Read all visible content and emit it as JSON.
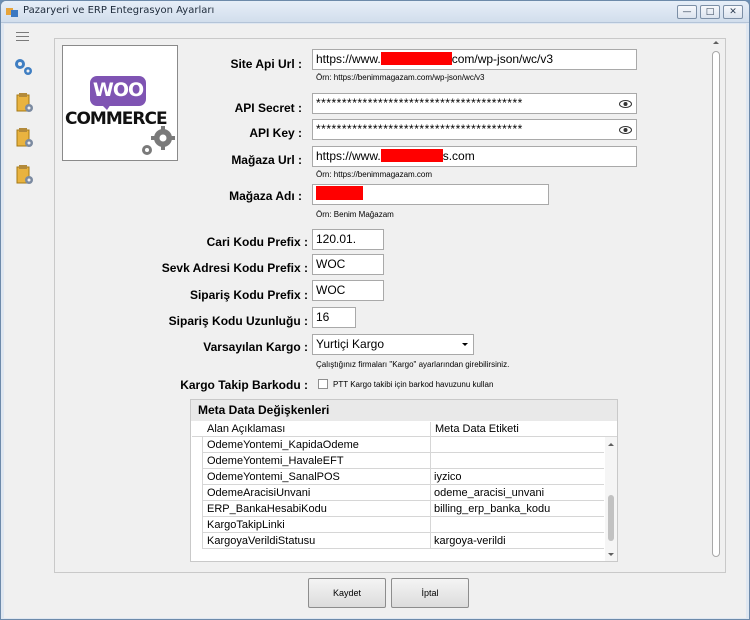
{
  "window": {
    "title": "Pazaryeri ve ERP Entegrasyon Ayarları",
    "controls": [
      "—",
      "□",
      "✕"
    ]
  },
  "logo": {
    "bubble_text": "WOO",
    "text": "COMMERCE"
  },
  "form": {
    "site_api_url": {
      "label": "Site Api Url :",
      "prefix": "https://www.",
      "suffix": "com/wp-json/wc/v3",
      "hint": "Örn: https://benimmagazam.com/wp-json/wc/v3"
    },
    "api_secret": {
      "label": "API Secret :",
      "value": "****************************************"
    },
    "api_key": {
      "label": "API Key :",
      "value": "****************************************"
    },
    "magaza_url": {
      "label": "Mağaza Url :",
      "prefix": "https://www.",
      "suffix": "s.com",
      "hint": "Örn: https://benimmagazam.com"
    },
    "magaza_adi": {
      "label": "Mağaza Adı :",
      "hint": "Örn: Benim Mağazam"
    },
    "cari_kodu_prefix": {
      "label": "Cari Kodu Prefix :",
      "value": "120.01."
    },
    "sevk_adresi_kodu_prefix": {
      "label": "Sevk Adresi Kodu Prefix :",
      "value": "WOC"
    },
    "siparis_kodu_prefix": {
      "label": "Sipariş Kodu Prefix :",
      "value": "WOC"
    },
    "siparis_kodu_uzunlugu": {
      "label": "Sipariş Kodu Uzunluğu :",
      "value": "16"
    },
    "varsayilan_kargo": {
      "label": "Varsayılan Kargo :",
      "value": "Yurtiçi Kargo",
      "hint": "Çalıştığınız firmaları \"Kargo\" ayarlarından girebilirsiniz."
    },
    "kargo_takip_barkodu": {
      "label": "Kargo Takip Barkodu :",
      "checkbox_label": "PTT Kargo takibi için barkod havuzunu kullan"
    }
  },
  "meta": {
    "title": "Meta Data Değişkenleri",
    "columns": [
      "Alan Açıklaması",
      "Meta Data Etiketi"
    ],
    "rows": [
      {
        "alan": "OdemeYontemi_KapidaOdeme",
        "etiket": ""
      },
      {
        "alan": "OdemeYontemi_HavaleEFT",
        "etiket": ""
      },
      {
        "alan": "OdemeYontemi_SanalPOS",
        "etiket": "iyzico"
      },
      {
        "alan": "OdemeAracisiUnvani",
        "etiket": "odeme_aracisi_unvani"
      },
      {
        "alan": "ERP_BankaHesabiKodu",
        "etiket": "billing_erp_banka_kodu"
      },
      {
        "alan": "KargoTakipLinki",
        "etiket": ""
      },
      {
        "alan": "KargoyaVerildiStatusu",
        "etiket": "kargoya-verildi"
      }
    ]
  },
  "buttons": {
    "save": "Kaydet",
    "cancel": "İptal"
  },
  "colors": {
    "woo_purple": "#7f54b3",
    "redaction": "#ff0000"
  }
}
